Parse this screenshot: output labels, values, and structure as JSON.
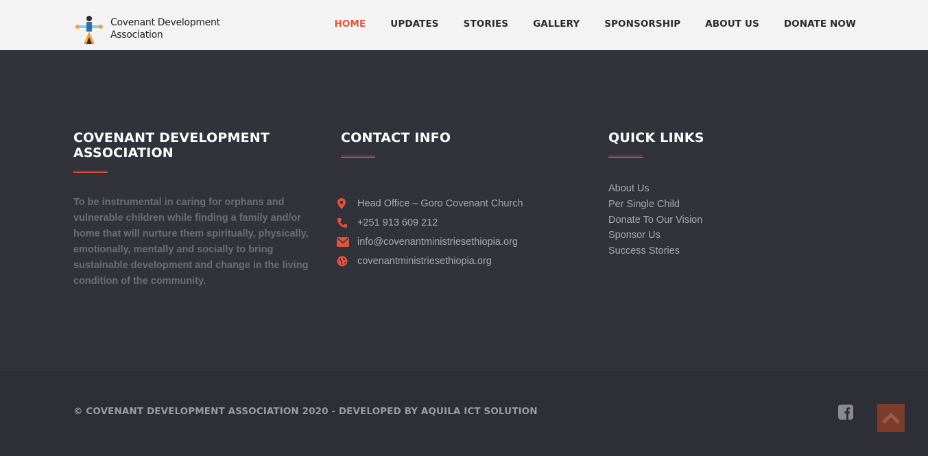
{
  "brand": {
    "name_line1": "Covenant Development",
    "name_line2": "Association"
  },
  "nav": {
    "items": [
      {
        "label": "HOME",
        "active": true
      },
      {
        "label": "UPDATES"
      },
      {
        "label": "STORIES"
      },
      {
        "label": "GALLERY"
      },
      {
        "label": "SPONSORSHIP"
      },
      {
        "label": "ABOUT US"
      },
      {
        "label": "DONATE NOW"
      }
    ]
  },
  "about": {
    "title_line1": "COVENANT DEVELOPMENT",
    "title_line2": "ASSOCIATION",
    "text": "To be instrumental in caring for orphans and vulnerable children while finding a family and/or home that will nurture them spiritually, physically, emotionally, mentally and socially to bring sustainable development and change in the living condition of the community."
  },
  "contact": {
    "title": "CONTACT INFO",
    "items": [
      {
        "icon": "map-marker-icon",
        "text": "Head Office – Goro Covenant Church"
      },
      {
        "icon": "phone-icon",
        "text": "+251 913 609 212"
      },
      {
        "icon": "envelope-icon",
        "text": "info@covenantministriesethiopia.org"
      },
      {
        "icon": "globe-icon",
        "text": "covenantministriesethiopia.org"
      }
    ]
  },
  "quick_links": {
    "title": "QUICK LINKS",
    "items": [
      "About Us",
      "Per Single Child",
      "Donate To Our Vision",
      "Sponsor Us",
      "Success Stories"
    ]
  },
  "footer": {
    "copyright": "© COVENANT DEVELOPMENT ASSOCIATION 2020 - DEVELOPED BY AQUILA ICT SOLUTION",
    "social_icon": "facebook-square-icon",
    "back_to_top_icon": "chevron-up-icon"
  },
  "colors": {
    "accent": "#e0543c",
    "footer_bg": "#32323b",
    "bottom_bg": "#2e2e36",
    "header_bg": "#f3f3f3"
  }
}
